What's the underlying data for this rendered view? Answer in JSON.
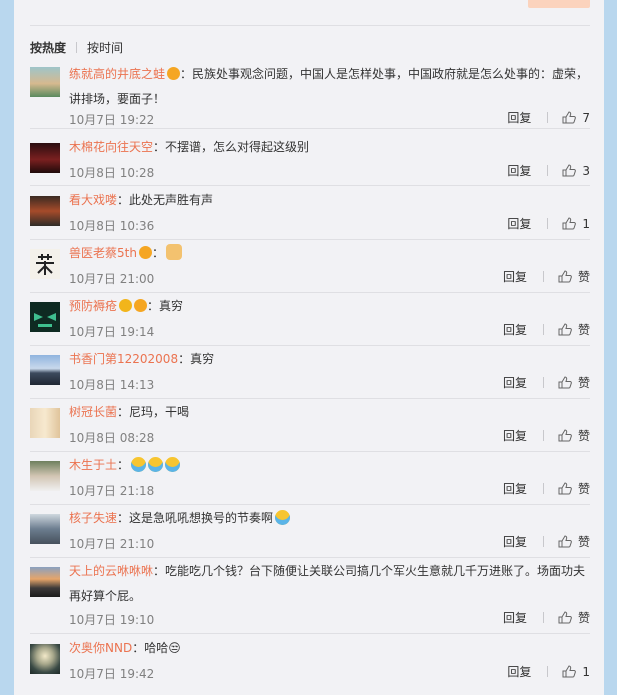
{
  "sort": {
    "hot": "按热度",
    "time": "按时间"
  },
  "comments": [
    {
      "user": "练就高的井底之蛙",
      "badge": "vip",
      "text": "：民族处事观念问题，中国人是怎样处事，中国政府就是怎么处事的：虚荣，讲排场，要面子！",
      "time": "10月7日 19:22",
      "reply": "回复",
      "like": "7"
    },
    {
      "user": "木棉花向往天空",
      "badge": "",
      "text": "：不摆谱，怎么对得起这级别",
      "time": "10月8日 10:28",
      "reply": "回复",
      "like": "3"
    },
    {
      "user": "看大戏喽",
      "badge": "",
      "text": "：此处无声胜有声",
      "time": "10月8日 10:36",
      "reply": "回复",
      "like": "1"
    },
    {
      "user": "兽医老蔡5th",
      "badge": "vip",
      "text": "：",
      "time": "10月7日 21:00",
      "reply": "回复",
      "like": "赞"
    },
    {
      "user": "预防褥疮",
      "badge": "vip+v",
      "text": "：真穷",
      "time": "10月7日 19:14",
      "reply": "回复",
      "like": "赞"
    },
    {
      "user": "书香门第12202008",
      "badge": "",
      "text": "：真穷",
      "time": "10月8日 14:13",
      "reply": "回复",
      "like": "赞"
    },
    {
      "user": "树冠长菌",
      "badge": "",
      "text": "：尼玛，干喝",
      "time": "10月8日 08:28",
      "reply": "回复",
      "like": "赞"
    },
    {
      "user": "木生于土",
      "badge": "",
      "text": "：",
      "time": "10月7日 21:18",
      "reply": "回复",
      "like": "赞"
    },
    {
      "user": "核子失速",
      "badge": "",
      "text": "：这是急吼吼想换号的节奏啊",
      "time": "10月7日 21:10",
      "reply": "回复",
      "like": "赞"
    },
    {
      "user": "天上的云咻咻咻",
      "badge": "",
      "text": "：吃能吃几个钱？台下随便让关联公司搞几个军火生意就几千万进账了。场面功夫再好算个屁。",
      "time": "10月7日 19:10",
      "reply": "回复",
      "like": "赞"
    },
    {
      "user": "次奥你NND",
      "badge": "",
      "text": "：哈哈😒",
      "time": "10月7日 19:42",
      "reply": "回复",
      "like": "1"
    }
  ],
  "colors": {
    "name": "#eb7350",
    "background": "#f2f2f5",
    "page": "#b9d7ee"
  }
}
